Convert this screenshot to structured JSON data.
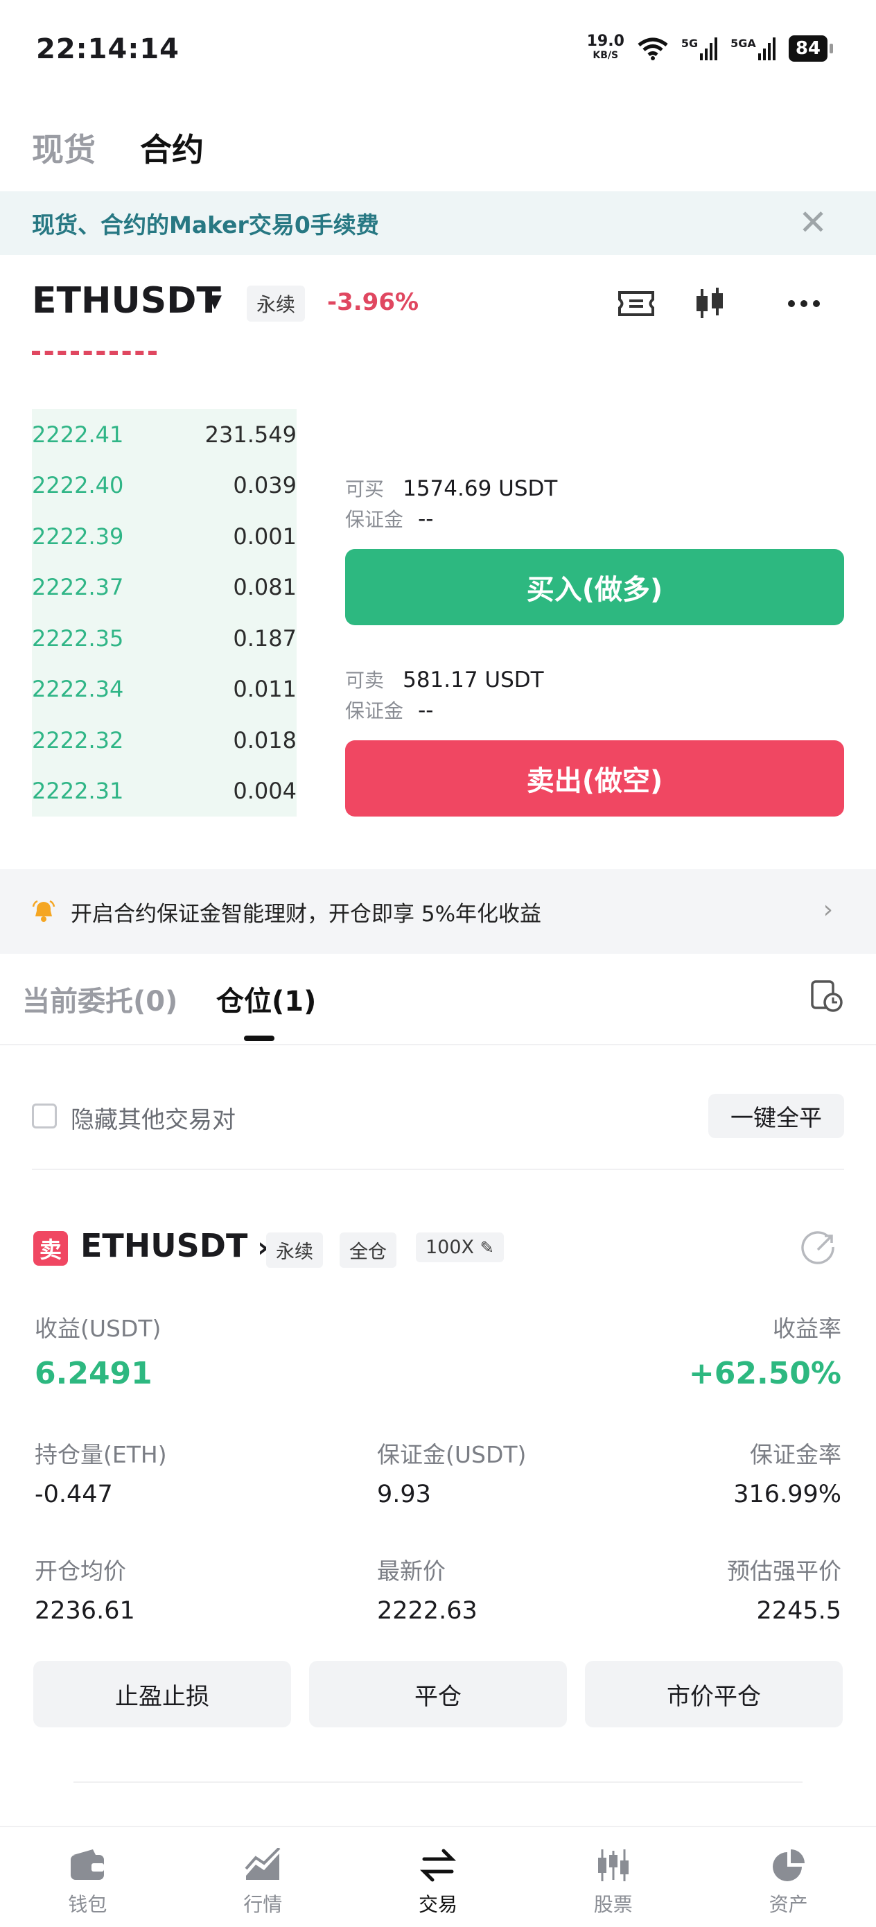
{
  "status_bar": {
    "time": "22:14:14",
    "net_speed": "19.0",
    "net_unit": "KB/S",
    "signal1": "5G",
    "signal2": "5GA",
    "battery": "84"
  },
  "top_tabs": {
    "spot": "现货",
    "contract": "合约"
  },
  "promo": {
    "text": "现货、合约的Maker交易0手续费"
  },
  "pair_header": {
    "symbol": "ETHUSDT",
    "type_tag": "永续",
    "change": "-3.96%"
  },
  "order_book": {
    "rows": [
      {
        "price": "2222.41",
        "qty": "231.549",
        "depth": 1.0
      },
      {
        "price": "2222.40",
        "qty": "0.039",
        "depth": 1.0
      },
      {
        "price": "2222.39",
        "qty": "0.001",
        "depth": 1.0
      },
      {
        "price": "2222.37",
        "qty": "0.081",
        "depth": 1.0
      },
      {
        "price": "2222.35",
        "qty": "0.187",
        "depth": 1.0
      },
      {
        "price": "2222.34",
        "qty": "0.011",
        "depth": 1.0
      },
      {
        "price": "2222.32",
        "qty": "0.018",
        "depth": 1.0
      },
      {
        "price": "2222.31",
        "qty": "0.004",
        "depth": 1.0
      }
    ]
  },
  "trade_panel": {
    "buy_avail_label": "可买",
    "buy_avail_value": "1574.69 USDT",
    "buy_margin_label": "保证金",
    "buy_margin_value": "--",
    "buy_button": "买入(做多)",
    "sell_avail_label": "可卖",
    "sell_avail_value": "581.17 USDT",
    "sell_margin_label": "保证金",
    "sell_margin_value": "--",
    "sell_button": "卖出(做空)"
  },
  "earn_banner": {
    "text": "开启合约保证金智能理财，开仓即享 5%年化收益"
  },
  "position_tabs": {
    "orders": "当前委托(0)",
    "positions": "仓位(1)"
  },
  "filters": {
    "hide_others": "隐藏其他交易对",
    "close_all": "一键全平"
  },
  "position": {
    "side_badge": "卖",
    "symbol": "ETHUSDT",
    "tag_perpetual": "永续",
    "tag_margin_mode": "全仓",
    "tag_leverage": "100X",
    "pnl_label": "收益(USDT)",
    "pnl_value": "6.2491",
    "roe_label": "收益率",
    "roe_value": "+62.50%",
    "size_label": "持仓量(ETH)",
    "size_value": "-0.447",
    "margin_label": "保证金(USDT)",
    "margin_value": "9.93",
    "margin_ratio_label": "保证金率",
    "margin_ratio_value": "316.99%",
    "entry_label": "开仓均价",
    "entry_value": "2236.61",
    "mark_label": "最新价",
    "mark_value": "2222.63",
    "liq_label": "预估强平价",
    "liq_value": "2245.5",
    "btn_tpsl": "止盈止损",
    "btn_close": "平仓",
    "btn_market_close": "市价平仓"
  },
  "bottom_nav": {
    "wallet": "钱包",
    "markets": "行情",
    "trade": "交易",
    "stocks": "股票",
    "assets": "资产"
  },
  "colors": {
    "green": "#2db880",
    "red": "#f04762",
    "teal": "#277883"
  }
}
